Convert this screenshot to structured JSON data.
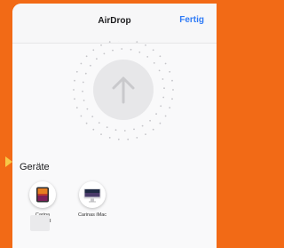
{
  "sheet": {
    "title": "AirDrop",
    "done_label": "Fertig"
  },
  "devices_section": {
    "heading": "Geräte",
    "items": [
      {
        "name": "Carina",
        "name_line2": "iPad",
        "icon": "ipad-icon"
      },
      {
        "name": "Carinas iMac",
        "icon": "imac-icon"
      }
    ]
  },
  "colors": {
    "background": "#f26a16",
    "accent": "#2f7bf6",
    "pointer": "#f7c948"
  }
}
